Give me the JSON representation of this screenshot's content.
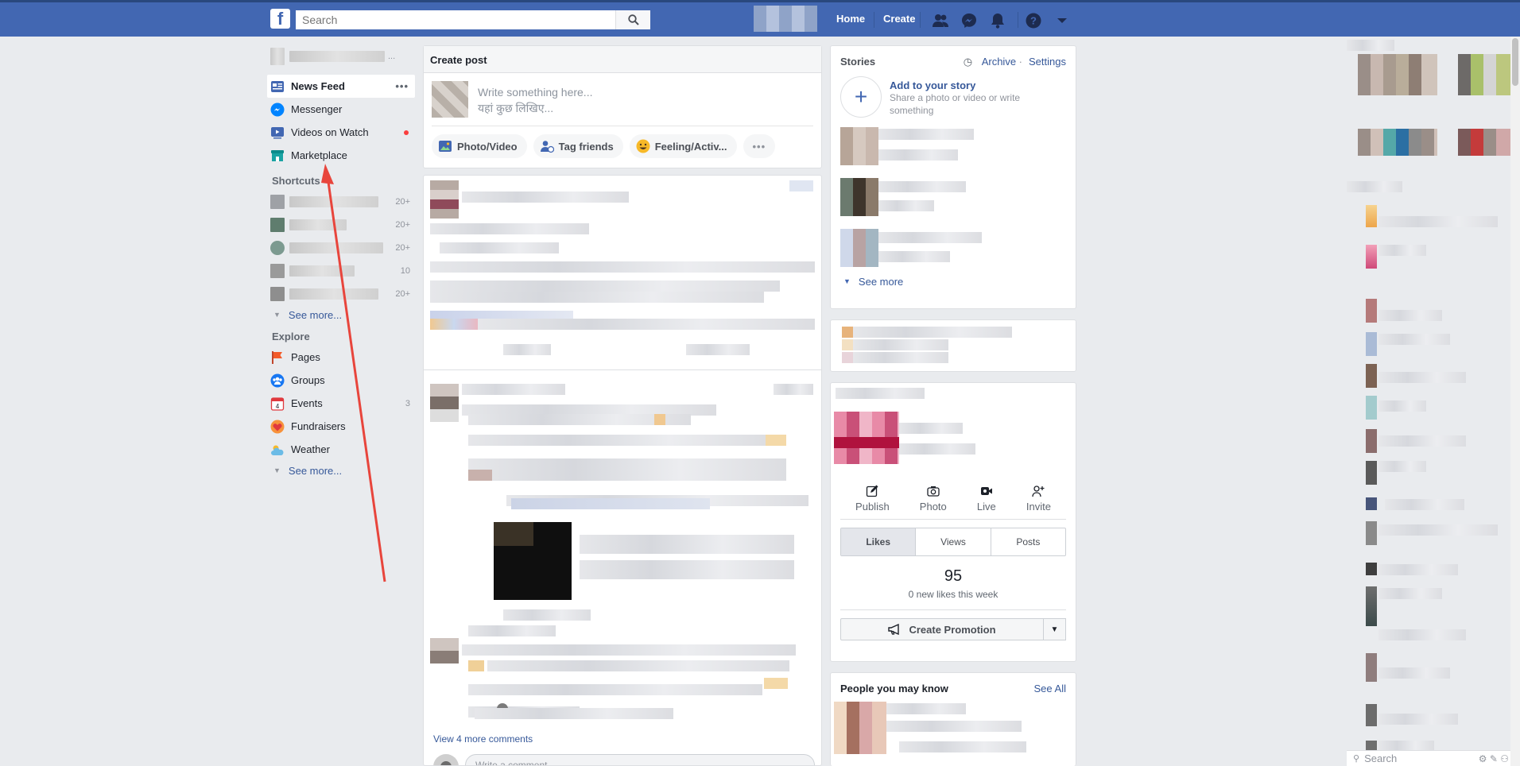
{
  "header": {
    "search_placeholder": "Search",
    "home": "Home",
    "create": "Create"
  },
  "left_nav": {
    "items": [
      {
        "label": "News Feed"
      },
      {
        "label": "Messenger"
      },
      {
        "label": "Videos on Watch"
      },
      {
        "label": "Marketplace"
      }
    ],
    "shortcuts_title": "Shortcuts",
    "shortcut_counts": [
      "20+",
      "20+",
      "20+",
      "10",
      "20+"
    ],
    "see_more_1": "See more...",
    "explore_title": "Explore",
    "explore": [
      {
        "label": "Pages",
        "count": ""
      },
      {
        "label": "Groups",
        "count": ""
      },
      {
        "label": "Events",
        "count": "3"
      },
      {
        "label": "Fundraisers",
        "count": ""
      },
      {
        "label": "Weather",
        "count": ""
      }
    ],
    "see_more_2": "See more..."
  },
  "composer": {
    "title": "Create post",
    "placeholder_line1": "Write something here...",
    "placeholder_line2": "यहां कुछ लिखिए...",
    "actions": [
      "Photo/Video",
      "Tag friends",
      "Feeling/Activ...",
      "•••"
    ]
  },
  "feed": {
    "view_more_comments": "View 4 more comments",
    "comment_placeholder": "Write a comment..."
  },
  "stories": {
    "title": "Stories",
    "archive": "Archive",
    "settings": "Settings",
    "add_title": "Add to your story",
    "add_sub": "Share a photo or video or write something",
    "see_more": "See more"
  },
  "page_panel": {
    "actions": [
      "Publish",
      "Photo",
      "Live",
      "Invite"
    ],
    "tabs": [
      "Likes",
      "Views",
      "Posts"
    ],
    "likes_count": "95",
    "likes_sub": "0 new likes this week",
    "create_promotion": "Create Promotion"
  },
  "people": {
    "title": "People you may know",
    "see_all": "See All"
  },
  "chat": {
    "search_placeholder": "Search"
  },
  "colors": {
    "brand": "#4267b2",
    "link": "#365899",
    "annotation_arrow": "#e8453c"
  }
}
